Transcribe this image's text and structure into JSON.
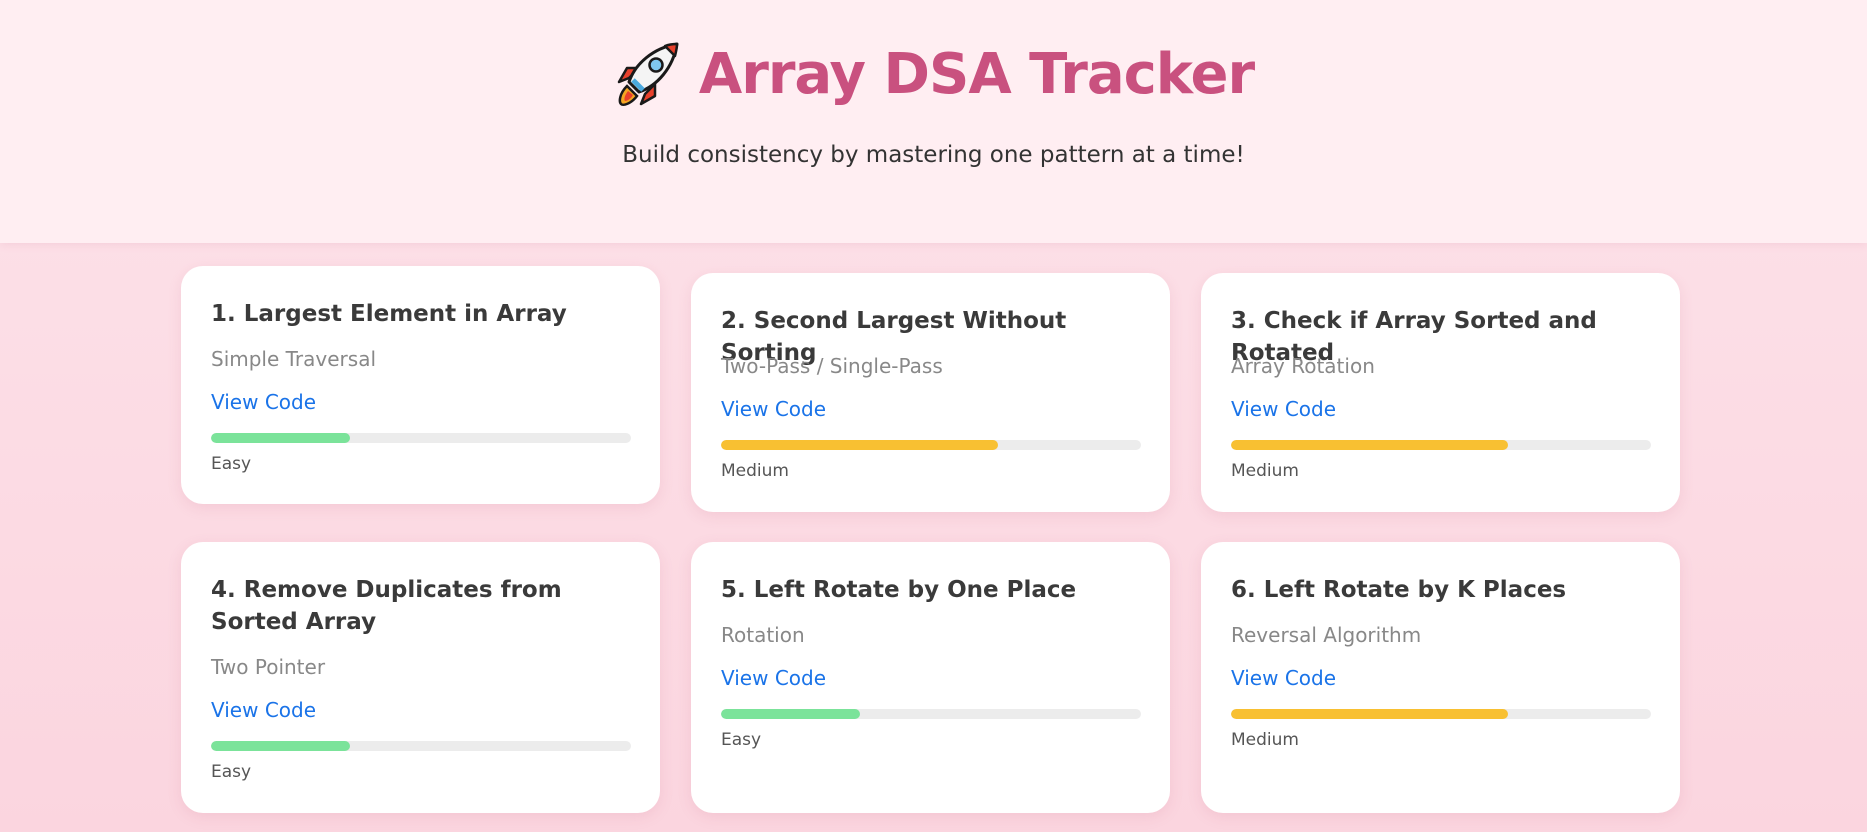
{
  "header": {
    "icon": "rocket-icon",
    "title": "Array DSA Tracker",
    "subtitle": "Build consistency by mastering one pattern at a time!"
  },
  "colors": {
    "title": "#c9517f",
    "easy": "#7be39a",
    "medium": "#f8c032",
    "link": "#1a73e8"
  },
  "cards": [
    {
      "title": "1. Largest Element in Array",
      "pattern": "Simple Traversal",
      "link": "View Code",
      "difficulty": "Easy",
      "progress": 0.33
    },
    {
      "title": "2. Second Largest Without Sorting",
      "pattern": "Two-Pass / Single-Pass",
      "link": "View Code",
      "difficulty": "Medium",
      "progress": 0.66
    },
    {
      "title": "3. Check if Array Sorted and Rotated",
      "pattern": "Array Rotation",
      "link": "View Code",
      "difficulty": "Medium",
      "progress": 0.66
    },
    {
      "title": "4. Remove Duplicates from Sorted Array",
      "pattern": "Two Pointer",
      "link": "View Code",
      "difficulty": "Easy",
      "progress": 0.33
    },
    {
      "title": "5. Left Rotate by One Place",
      "pattern": "Rotation",
      "link": "View Code",
      "difficulty": "Easy",
      "progress": 0.33
    },
    {
      "title": "6. Left Rotate by K Places",
      "pattern": "Reversal Algorithm",
      "link": "View Code",
      "difficulty": "Medium",
      "progress": 0.66
    }
  ]
}
